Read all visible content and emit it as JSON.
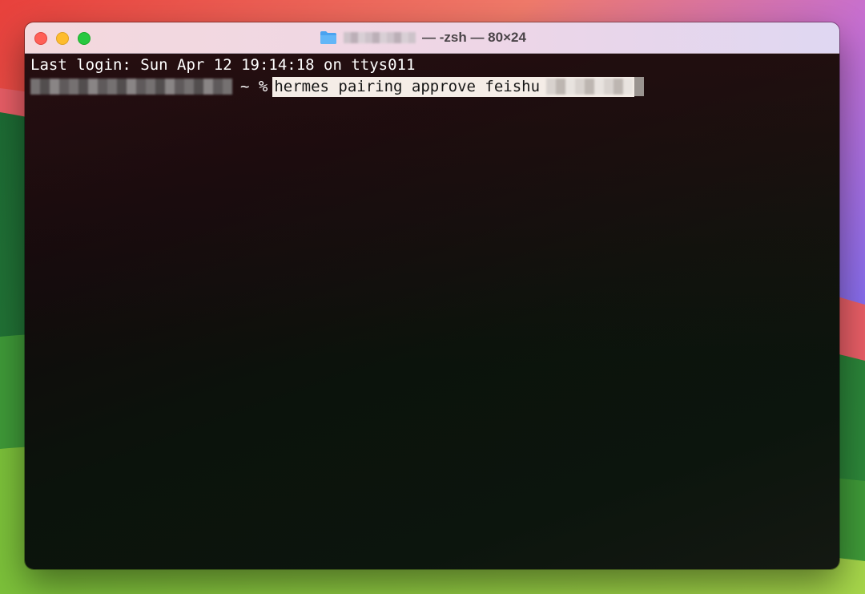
{
  "window": {
    "title_suffix": "— -zsh — 80×24",
    "title_icon": "folder-icon",
    "colors": {
      "close": "#ff5f57",
      "minimize": "#febc2e",
      "maximize": "#28c840",
      "terminal_background": "#0f1410",
      "selection_background": "#f5ede7"
    }
  },
  "terminal": {
    "last_login": "Last login: Sun Apr 12 19:14:18 on ttys011",
    "prompt_suffix": "~ %",
    "command": "hermes pairing approve feishu"
  }
}
